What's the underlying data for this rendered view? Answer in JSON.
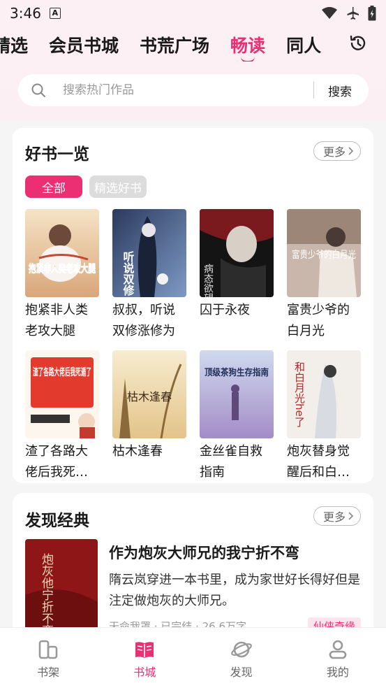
{
  "status_bar": {
    "time": "3:46",
    "badge_letter": "A"
  },
  "channel_tabs": [
    {
      "label": "精选",
      "active": false
    },
    {
      "label": "会员书城",
      "active": false
    },
    {
      "label": "书荒广场",
      "active": false
    },
    {
      "label": "畅读",
      "active": true
    },
    {
      "label": "同人",
      "active": false
    }
  ],
  "search": {
    "placeholder": "搜索热门作品",
    "value": "",
    "button_label": "搜索"
  },
  "good_books": {
    "title": "好书一览",
    "more_label": "更多",
    "filters": [
      {
        "label": "全部",
        "active": true
      },
      {
        "label": "精选好书",
        "active": false
      }
    ],
    "books": [
      {
        "title": "抱紧非人类老攻大腿",
        "cover_text": "抱紧非人类老攻大腿"
      },
      {
        "title": "叔叔，听说双修涨修为",
        "cover_text": "听说双修"
      },
      {
        "title": "囚于永夜",
        "cover_text": "病态欲望"
      },
      {
        "title": "富贵少爷的白月光",
        "cover_text": "富贵少爷的白月光"
      },
      {
        "title": "渣了各路大佬后我死遁了",
        "cover_text": "渣了各路大佬后我死遁了"
      },
      {
        "title": "枯木逢春",
        "cover_text": "枯木逢春"
      },
      {
        "title": "金丝雀自救指南",
        "cover_text": "顶级茶狗生存指南"
      },
      {
        "title": "炮灰替身觉醒后和白月光he了",
        "cover_text": "和白月光he了"
      }
    ]
  },
  "classics": {
    "title": "发现经典",
    "more_label": "更多",
    "book": {
      "title": "作为炮灰大师兄的我宁折不弯",
      "description": "隋云岚穿进一本书里，成为家世好长得好但是注定做炮灰的大师兄。",
      "meta": "天命我罩 · 已完结 · 26.6万字",
      "tag": "仙侠奇缘",
      "cover_text": "炮灰他宁折不弯"
    }
  },
  "bottom_nav": [
    {
      "label": "书架",
      "icon": "bookshelf-icon",
      "active": false
    },
    {
      "label": "书城",
      "icon": "open-book-icon",
      "active": true
    },
    {
      "label": "发现",
      "icon": "planet-icon",
      "active": false
    },
    {
      "label": "我的",
      "icon": "person-icon",
      "active": false
    }
  ],
  "colors": {
    "accent": "#ec2e73",
    "background": "#f5f5f5",
    "header_bg": "#fdf0f5"
  }
}
